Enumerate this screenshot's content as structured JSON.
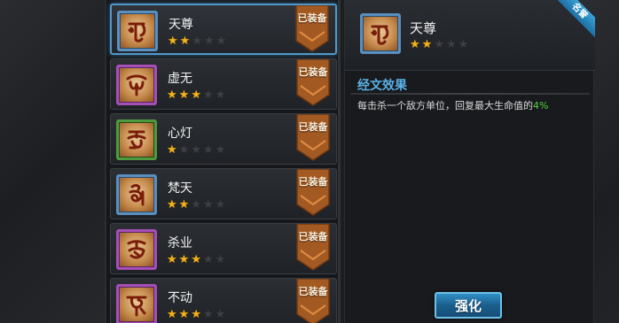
{
  "runes": [
    {
      "name": "天尊",
      "stars": 2,
      "max_stars": 5,
      "equipped_label": "已装备",
      "border": "blue",
      "glyph": "tianzun"
    },
    {
      "name": "虚无",
      "stars": 3,
      "max_stars": 5,
      "equipped_label": "已装备",
      "border": "purple",
      "glyph": "xuwu"
    },
    {
      "name": "心灯",
      "stars": 1,
      "max_stars": 5,
      "equipped_label": "已装备",
      "border": "green",
      "glyph": "xindeng"
    },
    {
      "name": "梵天",
      "stars": 2,
      "max_stars": 5,
      "equipped_label": "已装备",
      "border": "blue",
      "glyph": "fantian"
    },
    {
      "name": "杀业",
      "stars": 3,
      "max_stars": 5,
      "equipped_label": "已装备",
      "border": "purple",
      "glyph": "shaye"
    },
    {
      "name": "不动",
      "stars": 3,
      "max_stars": 5,
      "equipped_label": "已装备",
      "border": "purple",
      "glyph": "budong"
    }
  ],
  "selected_index": 0,
  "detail": {
    "name": "天尊",
    "stars": 2,
    "max_stars": 5,
    "ribbon": "名誉",
    "effect_title": "经文效果",
    "effect_text": "每击杀一个敌方单位，回复最大生命值的",
    "effect_value": "4%",
    "button_label": "强化"
  },
  "colors": {
    "star_on": "#f2b21e",
    "star_off": "#3c3f44",
    "effect_title": "#5ab0e6",
    "effect_value": "#54d23e",
    "border_blue": "#5a8fbf",
    "border_purple": "#a64fb8",
    "border_green": "#4f9a3d"
  }
}
